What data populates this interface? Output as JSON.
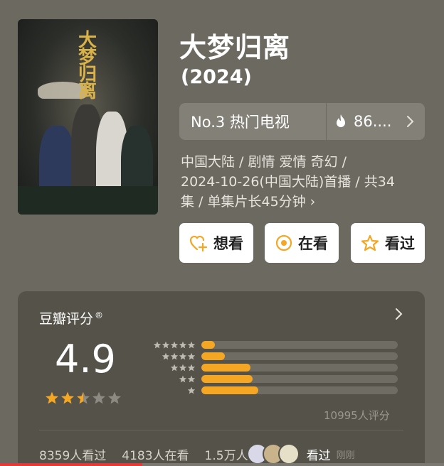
{
  "poster": {
    "art_text": "大梦归离"
  },
  "title": "大梦归离",
  "year": "(2024)",
  "rank": {
    "label": "No.3 热门电视",
    "heat": "86....",
    "heat_icon": "fire-icon"
  },
  "meta": {
    "line1": "中国大陆 / 剧情 爱情 奇幻 /",
    "line2": "2024-10-26(中国大陆)首播 / 共34",
    "line3": "集 / 单集片长45分钟",
    "more": "›"
  },
  "actions": {
    "want": "想看",
    "watching": "在看",
    "watched": "看过"
  },
  "rating": {
    "label": "豆瓣评分",
    "mark": "®",
    "score": "4.9",
    "stars": 2.5,
    "count": "10995人评分",
    "distribution": [
      {
        "stars": 5,
        "fraction": 0.07
      },
      {
        "stars": 4,
        "fraction": 0.12
      },
      {
        "stars": 3,
        "fraction": 0.25
      },
      {
        "stars": 2,
        "fraction": 0.26
      },
      {
        "stars": 1,
        "fraction": 0.29
      }
    ]
  },
  "footer": {
    "seen": "8359人看过",
    "watching": "4183人在看",
    "want": "1.5万人",
    "recent_action": "看过",
    "recent_time": "刚刚"
  },
  "colors": {
    "background": "#6b6960",
    "accent": "#f5a623",
    "card": "#555349"
  },
  "video_progress": 0.32
}
